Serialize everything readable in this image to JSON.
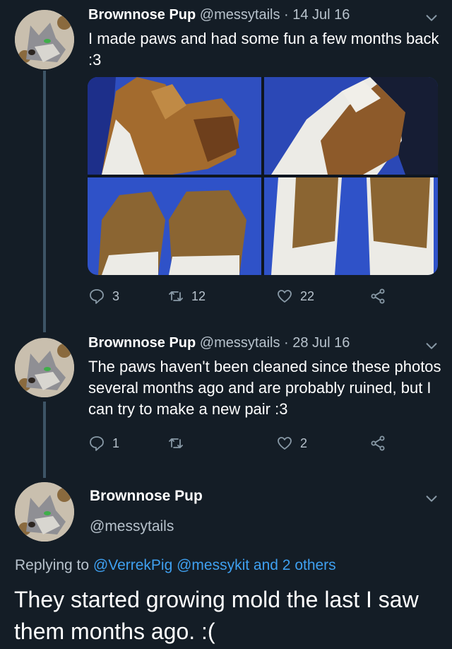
{
  "tweets": [
    {
      "display_name": "Brownnose Pup",
      "handle": "@messytails",
      "date": "· 14 Jul 16",
      "text": "I made paws and had some fun a few months back :3",
      "replies": "3",
      "retweets": "12",
      "likes": "22"
    },
    {
      "display_name": "Brownnose Pup",
      "handle": "@messytails",
      "date": "· 28 Jul 16",
      "text": "The paws haven't been cleaned since these photos several months ago and are probably ruined, but I can try to make a new pair :3",
      "replies": "1",
      "retweets": "",
      "likes": "2"
    }
  ],
  "main_tweet": {
    "display_name": "Brownnose Pup",
    "handle": "@messytails",
    "replying_prefix": "Replying to",
    "replying_to": "@VerrekPig @messykit and 2 others",
    "text": "They started growing mold the last I saw them months ago. :("
  },
  "icons": {
    "reply": "reply-bubble-icon",
    "retweet": "retweet-icon",
    "like": "heart-icon",
    "share": "share-icon",
    "menu": "chevron-down-icon"
  },
  "colors": {
    "background": "#141d26",
    "secondary_text": "#b7c2cc",
    "link": "#3fa0f0",
    "thread_line": "#3d5466"
  }
}
